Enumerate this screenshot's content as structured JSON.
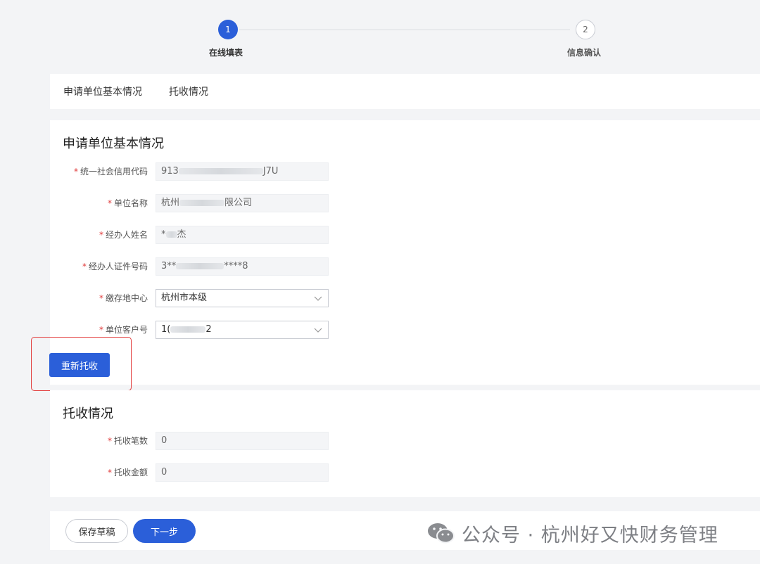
{
  "stepper": {
    "steps": [
      {
        "number": "1",
        "label": "在线填表"
      },
      {
        "number": "2",
        "label": "信息确认"
      }
    ]
  },
  "tabs": [
    "申请单位基本情况",
    "托收情况"
  ],
  "basic": {
    "title": "申请单位基本情况",
    "fields": [
      {
        "label": "统一社会信用代码",
        "value_prefix": "913",
        "value_suffix": "J7U"
      },
      {
        "label": "单位名称",
        "value_prefix": "杭州",
        "value_suffix": "限公司"
      },
      {
        "label": "经办人姓名",
        "value_prefix": "*",
        "value_suffix": "杰"
      },
      {
        "label": "经办人证件号码",
        "value_prefix": "3**",
        "value_suffix": "****8"
      },
      {
        "label": "缴存地中心",
        "value": "杭州市本级"
      },
      {
        "label": "单位客户号",
        "value_prefix": "1(",
        "value_suffix": "2"
      }
    ],
    "required_mark": "*",
    "rebill_button": "重新托收"
  },
  "collection": {
    "title": "托收情况",
    "fields": [
      {
        "label": "托收笔数",
        "value": "0"
      },
      {
        "label": "托收金额",
        "value": "0"
      }
    ]
  },
  "footer": {
    "save_draft": "保存草稿",
    "next": "下一步"
  },
  "watermark": {
    "text": "公众号 · 杭州好又快财务管理"
  },
  "colors": {
    "primary": "#2b5fd9",
    "required": "#e03b3b",
    "highlight": "#e23b3b"
  }
}
